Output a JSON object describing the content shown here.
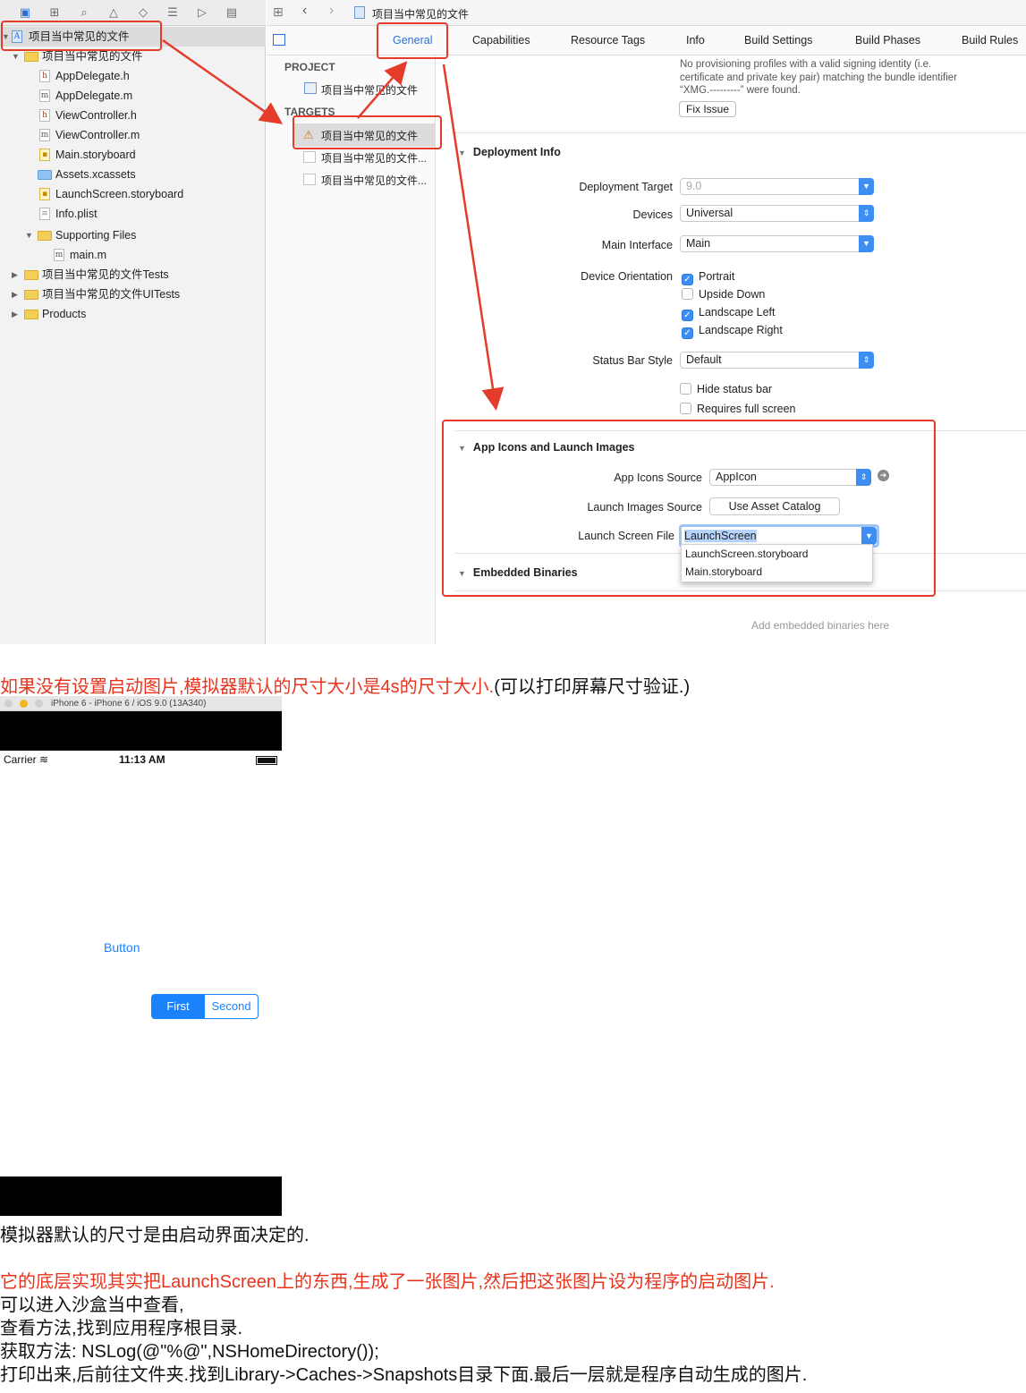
{
  "navigator": {
    "toolbar_icons": [
      "folder-icon",
      "hierarchy-icon",
      "search-icon",
      "warning-icon",
      "test-icon",
      "debug-icon",
      "breakpoint-icon",
      "report-icon"
    ],
    "tree": [
      {
        "label": "项目当中常见的文件",
        "kind": "project",
        "depth": 0
      },
      {
        "label": "项目当中常见的文件",
        "kind": "folder",
        "depth": 1
      },
      {
        "label": "AppDelegate.h",
        "kind": "h",
        "depth": 2
      },
      {
        "label": "AppDelegate.m",
        "kind": "m",
        "depth": 2
      },
      {
        "label": "ViewController.h",
        "kind": "h",
        "depth": 2
      },
      {
        "label": "ViewController.m",
        "kind": "m",
        "depth": 2
      },
      {
        "label": "Main.storyboard",
        "kind": "sb",
        "depth": 2
      },
      {
        "label": "Assets.xcassets",
        "kind": "assets",
        "depth": 2
      },
      {
        "label": "LaunchScreen.storyboard",
        "kind": "sb",
        "depth": 2
      },
      {
        "label": "Info.plist",
        "kind": "plist",
        "depth": 2
      },
      {
        "label": "Supporting Files",
        "kind": "folder",
        "depth": 2
      },
      {
        "label": "main.m",
        "kind": "m",
        "depth": 3
      },
      {
        "label": "项目当中常见的文件Tests",
        "kind": "folder",
        "depth": 1
      },
      {
        "label": "项目当中常见的文件UITests",
        "kind": "folder",
        "depth": 1
      },
      {
        "label": "Products",
        "kind": "folder",
        "depth": 1
      }
    ]
  },
  "editor": {
    "breadcrumb": "项目当中常见的文件",
    "tabs": [
      "General",
      "Capabilities",
      "Resource Tags",
      "Info",
      "Build Settings",
      "Build Phases",
      "Build Rules"
    ],
    "project_header": "PROJECT",
    "project_item": "项目当中常见的文件",
    "targets_header": "TARGETS",
    "targets": [
      "项目当中常见的文件",
      "项目当中常见的文件...",
      "项目当中常见的文件..."
    ]
  },
  "signing": {
    "message_1": "No provisioning profiles with a valid signing identity (i.e.",
    "message_2": "certificate and private key pair) matching the bundle identifier",
    "message_3": "“XMG.---------” were found.",
    "fix_label": "Fix Issue"
  },
  "deployment": {
    "title": "Deployment Info",
    "target_label": "Deployment Target",
    "target_value": "9.0",
    "devices_label": "Devices",
    "devices_value": "Universal",
    "main_interface_label": "Main Interface",
    "main_interface_value": "Main",
    "orientation_label": "Device Orientation",
    "orientations": [
      {
        "label": "Portrait",
        "checked": true
      },
      {
        "label": "Upside Down",
        "checked": false
      },
      {
        "label": "Landscape Left",
        "checked": true
      },
      {
        "label": "Landscape Right",
        "checked": true
      }
    ],
    "status_bar_label": "Status Bar Style",
    "status_bar_value": "Default",
    "hide_status_bar": "Hide status bar",
    "requires_full_screen": "Requires full screen"
  },
  "app_icons": {
    "title": "App Icons and Launch Images",
    "icons_source_label": "App Icons Source",
    "icons_source_value": "AppIcon",
    "launch_images_label": "Launch Images Source",
    "launch_images_button": "Use Asset Catalog",
    "launch_screen_label": "Launch Screen File",
    "launch_screen_value": "LaunchScreen",
    "dropdown_options": [
      "LaunchScreen.storyboard",
      "Main.storyboard"
    ]
  },
  "embedded": {
    "title": "Embedded Binaries",
    "placeholder": "Add embedded binaries here"
  },
  "captions": {
    "line1_red": "如果没有设置启动图片,模拟器默认的尺寸大小是4s的尺寸大小.",
    "line1_black": "(可以打印屏幕尺寸验证.)",
    "line2": "模拟器默认的尺寸是由启动界面决定的.",
    "line3_red": "它的底层实现其实把LaunchScreen上的东西,生成了一张图片,然后把这张图片设为程序的启动图片.",
    "line4": "可以进入沙盒当中查看,",
    "line5": "查看方法,找到应用程序根目录.",
    "line6": "获取方法: NSLog(@\"%@\",NSHomeDirectory());",
    "line7": "打印出来,后前往文件夹.找到Library->Caches->Snapshots目录下面.最后一层就是程序自动生成的图片."
  },
  "simulator": {
    "title": "iPhone 6 - iPhone 6 / iOS 9.0 (13A340)",
    "carrier": "Carrier",
    "time": "11:13 AM",
    "button_label": "Button",
    "segments": [
      "First",
      "Second"
    ],
    "accent": "#1a82fb"
  },
  "colors": {
    "annotation_red": "#e43b2b",
    "xcode_blue": "#3d8ef3"
  }
}
